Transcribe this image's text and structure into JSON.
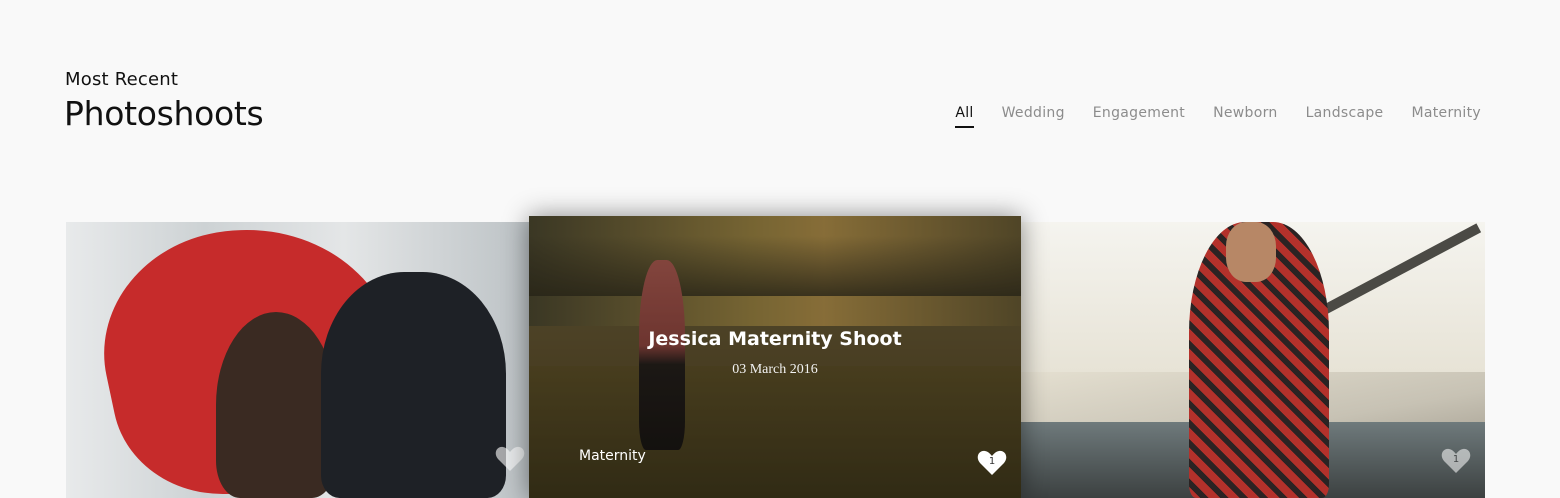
{
  "header": {
    "eyebrow": "Most Recent",
    "title": "Photoshoots"
  },
  "filters": [
    {
      "label": "All",
      "active": true
    },
    {
      "label": "Wedding",
      "active": false
    },
    {
      "label": "Engagement",
      "active": false
    },
    {
      "label": "Newborn",
      "active": false
    },
    {
      "label": "Landscape",
      "active": false
    },
    {
      "label": "Maternity",
      "active": false
    }
  ],
  "cards": [
    {
      "likes": ""
    },
    {
      "title": "Jessica Maternity Shoot",
      "date": "03 March 2016",
      "category": "Maternity",
      "likes": "1"
    },
    {
      "likes": "1"
    }
  ],
  "colors": {
    "background": "#f9f9f9",
    "active_filter": "#111111",
    "inactive_filter": "#8c8c8c"
  }
}
